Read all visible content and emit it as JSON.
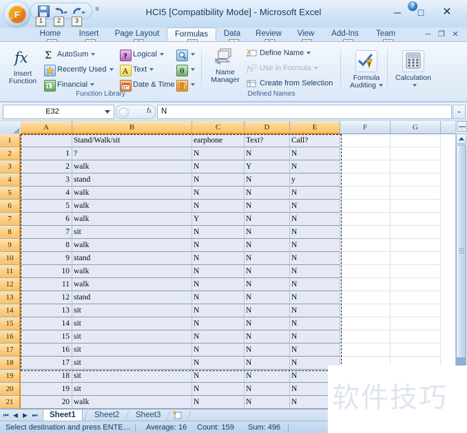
{
  "window": {
    "title": "HCI5  [Compatibility Mode] - Microsoft Excel",
    "minimize": "─",
    "maximize": "□",
    "close": "✕",
    "office_button_letter": "F",
    "qat": {
      "more_glyph": "≡",
      "items": [
        {
          "name": "save",
          "keytip": "1"
        },
        {
          "name": "undo",
          "keytip": "2"
        },
        {
          "name": "redo",
          "keytip": "3"
        }
      ]
    }
  },
  "ribbon": {
    "tabs": [
      {
        "label": "Home",
        "keytip": "H",
        "active": false
      },
      {
        "label": "Insert",
        "keytip": "N",
        "active": false
      },
      {
        "label": "Page Layout",
        "keytip": "P",
        "active": false
      },
      {
        "label": "Formulas",
        "keytip": "M",
        "active": true
      },
      {
        "label": "Data",
        "keytip": "A",
        "active": false
      },
      {
        "label": "Review",
        "keytip": "R",
        "active": false
      },
      {
        "label": "View",
        "keytip": "W",
        "active": false
      },
      {
        "label": "Add-Ins",
        "keytip": "X",
        "active": false
      },
      {
        "label": "Team",
        "keytip": "Y",
        "active": false
      }
    ],
    "window_icons": {
      "help": "?",
      "minimize": "─",
      "restore": "❐",
      "close": "✕"
    },
    "groups": [
      {
        "name": "Function Library",
        "label": "Function Library",
        "insert_function": "Insert Function",
        "items": [
          {
            "label": "AutoSum",
            "has_caret": true
          },
          {
            "label": "Recently Used",
            "has_caret": true
          },
          {
            "label": "Financial",
            "has_caret": true
          },
          {
            "label": "Logical",
            "has_caret": true
          },
          {
            "label": "Text",
            "has_caret": true
          },
          {
            "label": "Date & Time",
            "has_caret": true
          }
        ]
      },
      {
        "name": "Defined Names",
        "label": "Defined Names",
        "name_manager": "Name Manager",
        "items": [
          {
            "label": "Define Name",
            "has_caret": true,
            "disabled": false
          },
          {
            "label": "Use in Formula",
            "has_caret": true,
            "disabled": true
          },
          {
            "label": "Create from Selection",
            "has_caret": false,
            "disabled": false
          }
        ]
      },
      {
        "name": "Formula Auditing",
        "label": "Formula Auditing"
      },
      {
        "name": "Calculation",
        "label": "Calculation"
      }
    ]
  },
  "formula_bar": {
    "name_box_value": "E32",
    "fx_label": "fx",
    "formula_value": "N",
    "expand_glyph": "⌄"
  },
  "grid": {
    "columns": [
      {
        "label": "A",
        "selected": true
      },
      {
        "label": "B",
        "selected": true
      },
      {
        "label": "C",
        "selected": true
      },
      {
        "label": "D",
        "selected": true
      },
      {
        "label": "E",
        "selected": true
      },
      {
        "label": "F",
        "selected": false
      },
      {
        "label": "G",
        "selected": false
      }
    ],
    "row_numbers": [
      1,
      2,
      3,
      4,
      5,
      6,
      7,
      8,
      9,
      10,
      11,
      12,
      13,
      14,
      15,
      16,
      17,
      18,
      19,
      20,
      21
    ],
    "rows": [
      {
        "n": 1,
        "a": "",
        "b": "Stand/Walk/sit",
        "c": "earphone",
        "d": "Text?",
        "e": "Call?"
      },
      {
        "n": 2,
        "a": "1",
        "b": "?",
        "c": "N",
        "d": "N",
        "e": "N"
      },
      {
        "n": 3,
        "a": "2",
        "b": "walk",
        "c": "N",
        "d": "Y",
        "e": "N"
      },
      {
        "n": 4,
        "a": "3",
        "b": "stand",
        "c": "N",
        "d": "N",
        "e": "y"
      },
      {
        "n": 5,
        "a": "4",
        "b": "walk",
        "c": "N",
        "d": "N",
        "e": "N"
      },
      {
        "n": 6,
        "a": "5",
        "b": "walk",
        "c": "N",
        "d": "N",
        "e": "N"
      },
      {
        "n": 7,
        "a": "6",
        "b": "walk",
        "c": "Y",
        "d": "N",
        "e": "N"
      },
      {
        "n": 8,
        "a": "7",
        "b": "sit",
        "c": "N",
        "d": "N",
        "e": "N"
      },
      {
        "n": 9,
        "a": "8",
        "b": "walk",
        "c": "N",
        "d": "N",
        "e": "N"
      },
      {
        "n": 10,
        "a": "9",
        "b": "stand",
        "c": "N",
        "d": "N",
        "e": "N"
      },
      {
        "n": 11,
        "a": "10",
        "b": "walk",
        "c": "N",
        "d": "N",
        "e": "N"
      },
      {
        "n": 12,
        "a": "11",
        "b": "walk",
        "c": "N",
        "d": "N",
        "e": "N"
      },
      {
        "n": 13,
        "a": "12",
        "b": "stand",
        "c": "N",
        "d": "N",
        "e": "N"
      },
      {
        "n": 14,
        "a": "13",
        "b": "sit",
        "c": "N",
        "d": "N",
        "e": "N"
      },
      {
        "n": 15,
        "a": "14",
        "b": "sit",
        "c": "N",
        "d": "N",
        "e": "N"
      },
      {
        "n": 16,
        "a": "15",
        "b": "sit",
        "c": "N",
        "d": "N",
        "e": "N"
      },
      {
        "n": 17,
        "a": "16",
        "b": "sit",
        "c": "N",
        "d": "N",
        "e": "N"
      },
      {
        "n": 18,
        "a": "17",
        "b": "sit",
        "c": "N",
        "d": "N",
        "e": "N"
      },
      {
        "n": 19,
        "a": "18",
        "b": "sit",
        "c": "N",
        "d": "N",
        "e": "N"
      },
      {
        "n": 20,
        "a": "19",
        "b": "sit",
        "c": "N",
        "d": "N",
        "e": "N"
      },
      {
        "n": 21,
        "a": "20",
        "b": "walk",
        "c": "N",
        "d": "N",
        "e": "N"
      }
    ]
  },
  "sheet_tabs": {
    "nav": [
      "⏮",
      "◀",
      "▶",
      "⏭"
    ],
    "tabs": [
      {
        "label": "Sheet1",
        "active": true
      },
      {
        "label": "Sheet2",
        "active": false
      },
      {
        "label": "Sheet3",
        "active": false
      }
    ]
  },
  "status_bar": {
    "message": "Select destination and press ENTE…",
    "average": "Average: 16",
    "count": "Count: 159",
    "sum": "Sum: 496"
  },
  "watermark": {
    "text": "软件技巧"
  },
  "colors": {
    "selection_header": "#fbcf86",
    "selection_cell": "#e4e9f5",
    "accent_blue": "#1f3864",
    "marquee": "#1a1a1a"
  }
}
